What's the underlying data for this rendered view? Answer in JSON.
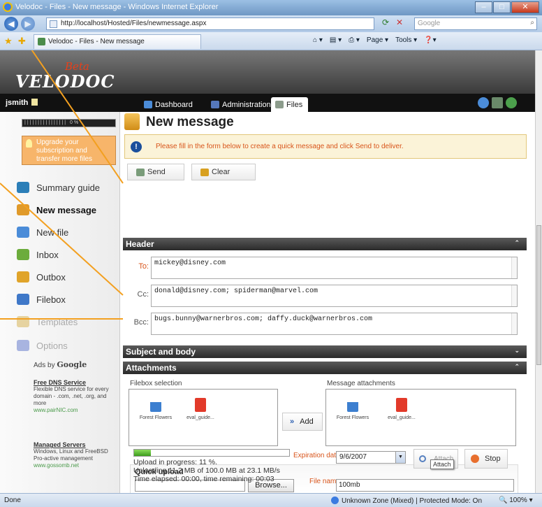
{
  "browser": {
    "title": "Velodoc - Files - New message - Windows Internet Explorer",
    "url": "http://localhost/Hosted/Files/newmessage.aspx",
    "search_placeholder": "Google",
    "tab_title": "Velodoc - Files - New message",
    "commands": [
      "Page ▾",
      "Tools ▾"
    ],
    "status_left": "Done",
    "status_zone": "Unknown Zone (Mixed) | Protected Mode: On",
    "zoom": "100%"
  },
  "app": {
    "logo": "VELODOC",
    "beta": "Beta",
    "user": "jsmith",
    "nav_tabs": [
      "Dashboard",
      "Administration",
      "Files"
    ],
    "active_tab": "Files",
    "quota_text": "0%",
    "upgrade_text": "Upgrade your subscription and transfer more files"
  },
  "sidebar": {
    "items": [
      {
        "label": "Summary guide",
        "icon": "summary-icon",
        "color": "#2c7fb8"
      },
      {
        "label": "New message",
        "icon": "new-message-icon",
        "color": "#e09a2a"
      },
      {
        "label": "New file",
        "icon": "new-file-icon",
        "color": "#4b8cd8"
      },
      {
        "label": "Inbox",
        "icon": "inbox-icon",
        "color": "#6cac3c"
      },
      {
        "label": "Outbox",
        "icon": "outbox-icon",
        "color": "#e0a42a"
      },
      {
        "label": "Filebox",
        "icon": "filebox-icon",
        "color": "#3f78c8"
      },
      {
        "label": "Templates",
        "icon": "templates-icon",
        "color": "#d8b44a"
      },
      {
        "label": "Options",
        "icon": "options-icon",
        "color": "#6a7cc8"
      }
    ],
    "ads_label": "Ads by",
    "ads_brand": "Google",
    "ads": [
      {
        "title": "Free DNS Service",
        "body": "Flexible DNS service for every domain - .com, .net, .org, and more",
        "url": "www.pairNIC.com"
      },
      {
        "title": "Managed Servers",
        "body": "Windows, Linux and FreeBSD Pro-active management",
        "url": "www.gossomb.net"
      }
    ]
  },
  "main": {
    "title": "New message",
    "notice": "Please fill in the form below to create a quick message and click Send to deliver.",
    "send_label": "Send",
    "clear_label": "Clear",
    "header_section": "Header",
    "to_label": "To:",
    "to_value": "mickey@disney.com",
    "cc_label": "Cc:",
    "cc_value": "donald@disney.com; spiderman@marvel.com",
    "bcc_label": "Bcc:",
    "bcc_value": "bugs.bunny@warnerbros.com; daffy.duck@warnerbros.com",
    "subject_section": "Subject and body",
    "attachments_section": "Attachments",
    "filebox_label": "Filebox selection",
    "attachments_label": "Message attachments",
    "files": [
      "Forest Flowers",
      "eval_guide..."
    ],
    "add_label": "Add",
    "quick_upload": "Quick upload",
    "browse_label": "Browse...",
    "file_name_label": "File name:",
    "file_name_value": "100mb",
    "expiration_label": "Expiration date:",
    "expiration_value": "9/6/2007",
    "attach_label": "Attach",
    "attach_tooltip": "Attach",
    "stop_label": "Stop",
    "progress_fraction": 0.11,
    "progress_line1": "Upload in progress: 11 %.",
    "progress_line2": "Uploading 11.2 MB of 100.0 MB at 23.1 MB/s",
    "progress_line3": "Time elapsed: 00:00, time remaining: 00:03"
  }
}
